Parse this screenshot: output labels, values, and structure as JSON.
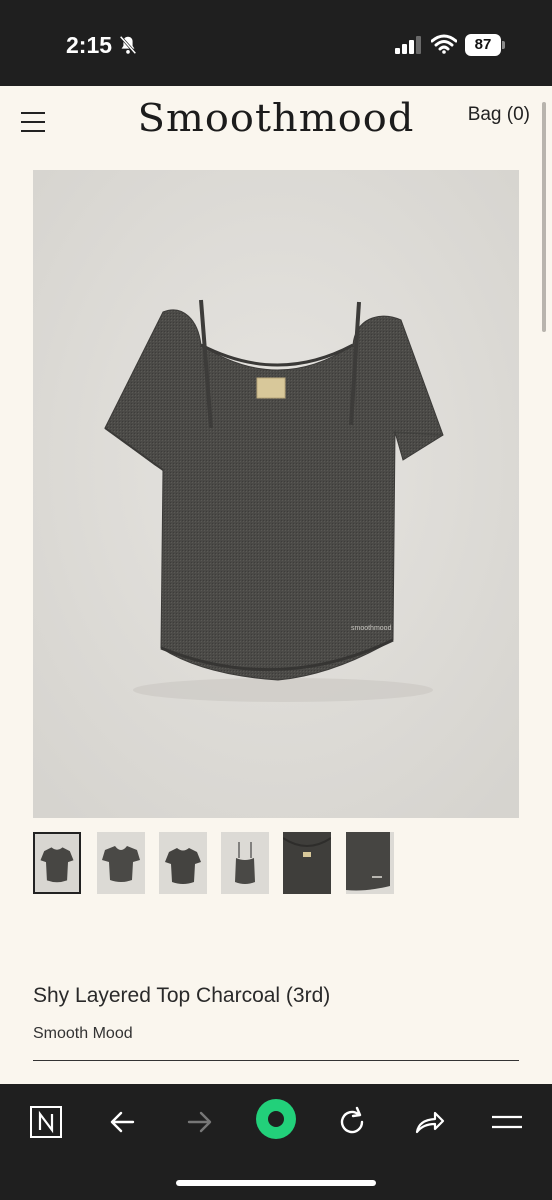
{
  "status_bar": {
    "time": "2:15",
    "battery": "87"
  },
  "header": {
    "brand": "Smoothmood",
    "bag_label": "Bag (0)"
  },
  "product": {
    "title": "Shy Layered Top Charcoal (3rd)",
    "brand": "Smooth Mood",
    "image_label": "smoothmood"
  },
  "thumbnails": [
    "front-view",
    "back-view",
    "front-flat",
    "inner-cami",
    "neck-detail",
    "hem-detail"
  ],
  "colors": {
    "fabric": "#4a4946",
    "accent_green": "#22d07a",
    "page_bg": "#faf6ee"
  },
  "toolbar": {
    "icons": [
      "notion-icon",
      "back-arrow-icon",
      "forward-arrow-icon",
      "record-icon",
      "reload-icon",
      "share-icon",
      "menu-icon"
    ]
  }
}
